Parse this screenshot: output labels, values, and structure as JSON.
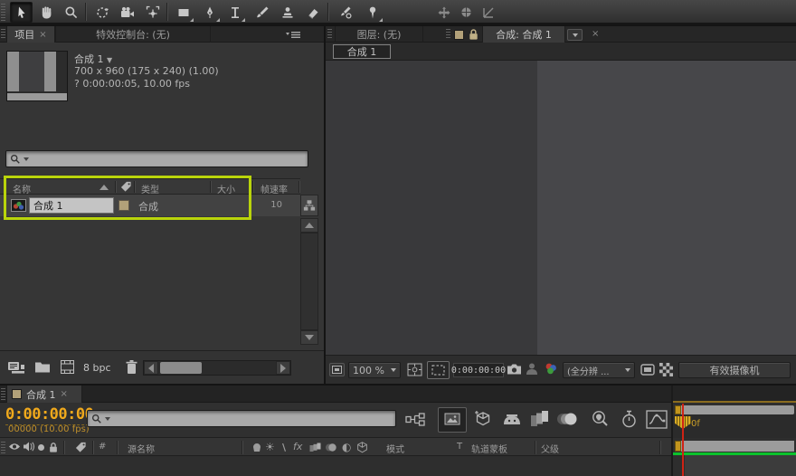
{
  "colors": {
    "selection_highlight_green": "#b9d40b",
    "timecode_orange": "#f0a91c",
    "cti_red": "#cf2315",
    "rendered_frames_green": "#0cc22c",
    "ruler_gold": "#c2951d",
    "label_tan": "#b2a179"
  },
  "toolbar": {
    "tool_icons": [
      "selection",
      "hand",
      "zoom",
      "rotation",
      "unified-camera",
      "pan-behind",
      "rectangle",
      "pen",
      "type",
      "brush",
      "clone-stamp",
      "eraser",
      "roto-brush",
      "puppet-pin"
    ],
    "axis_mode_icons": [
      "local-axis",
      "world-axis",
      "view-axis"
    ]
  },
  "project_panel": {
    "tab_project": "项目",
    "tab_effect_controls": "特效控制台: (无)",
    "info": {
      "comp_name": "合成 1",
      "dimensions": "700 x 960  (175 x 240) (1.00)",
      "duration": "? 0:00:00:05, 10.00 fps"
    },
    "search_value": "",
    "columns": {
      "name": "名称",
      "type": "类型",
      "size": "大小",
      "frame_rate": "帧速率"
    },
    "rows": [
      {
        "name": "合成 1",
        "type": "合成",
        "frame_rate": "10"
      }
    ],
    "bit_depth": "8 bpc"
  },
  "comp_panel": {
    "tab_layer": "图层: (无)",
    "tab_comp": "合成: 合成 1",
    "viewer_tab": "合成 1",
    "footer": {
      "zoom_level": "100 %",
      "timecode": "0:00:00:00",
      "resolution": "(全分辨 ...",
      "view_camera": "有效摄像机"
    }
  },
  "timeline_panel": {
    "tab": "合成 1",
    "timecode": "0:00:00:00",
    "frame_info": "00000 (10.00 fps)",
    "search_value": "",
    "ruler_first_label": "0f",
    "columns": {
      "index": "#",
      "source_name": "源名称",
      "mode": "模式",
      "t": "T",
      "track_matte": "轨道蒙板",
      "parent": "父级"
    }
  }
}
